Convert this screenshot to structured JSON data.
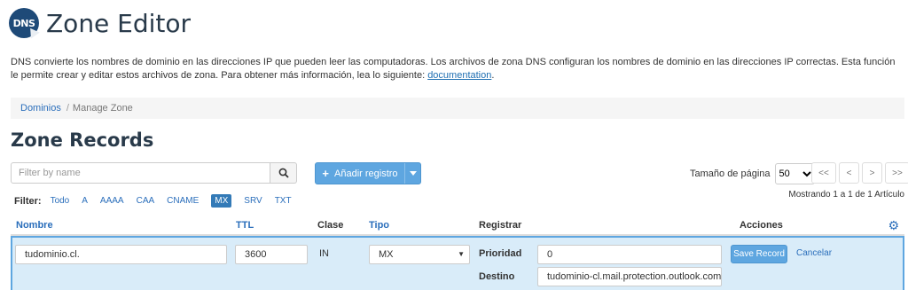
{
  "header": {
    "logo_text": "DNS",
    "title": "Zone Editor"
  },
  "description": {
    "text": "DNS convierte los nombres de dominio en las direcciones IP que pueden leer las computadoras. Los archivos de zona DNS configuran los nombres de dominio en las direcciones IP correctas. Esta función le permite crear y editar estos archivos de zona. Para obtener más información, lea lo siguiente: ",
    "link": "documentation",
    "end": "."
  },
  "breadcrumb": {
    "parent": "Dominios",
    "separator": "/",
    "current": "Manage Zone"
  },
  "section_title": "Zone Records",
  "search": {
    "placeholder": "Filter by name"
  },
  "add_button": {
    "label": "Añadir registro"
  },
  "pagination": {
    "page_size_label": "Tamaño de página",
    "page_size_value": "50",
    "first": "<<",
    "prev": "<",
    "next": ">",
    "last": ">>",
    "showing": "Mostrando 1 a 1 de 1 Artículo"
  },
  "filter": {
    "label": "Filter:",
    "options": [
      "Todo",
      "A",
      "AAAA",
      "CAA",
      "CNAME",
      "MX",
      "SRV",
      "TXT"
    ],
    "active": "MX"
  },
  "table": {
    "headers": {
      "name": "Nombre",
      "ttl": "TTL",
      "class": "Clase",
      "type": "Tipo",
      "record": "Registrar",
      "actions": "Acciones"
    },
    "edit_row": {
      "name": "tudominio.cl.",
      "ttl": "3600",
      "class": "IN",
      "type": "MX",
      "priority_label": "Prioridad",
      "priority": "0",
      "destination_label": "Destino",
      "destination": "tudominio-cl.mail.protection.outlook.com",
      "save": "Save Record",
      "cancel": "Cancelar"
    }
  },
  "colors": {
    "primary": "#5ea6e0",
    "link": "#2a6ebb",
    "row_highlight": "#d9ecf9",
    "title": "#293a4a"
  }
}
